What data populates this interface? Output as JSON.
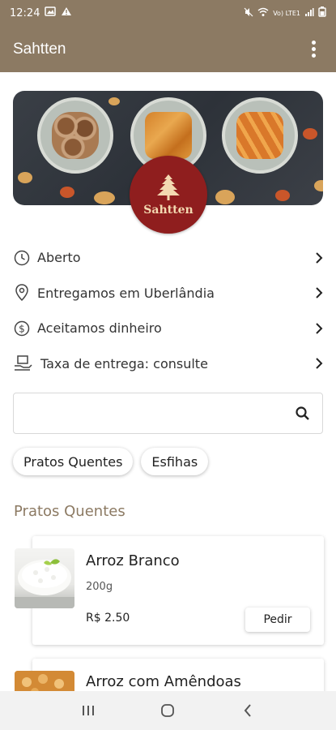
{
  "status_bar": {
    "time": "12:24",
    "signal_text": "Vo) LTE1"
  },
  "app_bar": {
    "title": "Sahtten",
    "menu_icon": "more-vert-icon"
  },
  "banner": {
    "logo_text": "Sahtten"
  },
  "info": [
    {
      "icon": "clock-icon",
      "label": "Aberto"
    },
    {
      "icon": "location-pin-icon",
      "label": "Entregamos em Uberlândia"
    },
    {
      "icon": "dollar-icon",
      "label": "Aceitamos dinheiro"
    },
    {
      "icon": "delivery-hand-icon",
      "label": "Taxa de entrega: consulte"
    }
  ],
  "search": {
    "value": "",
    "placeholder": ""
  },
  "categories": [
    {
      "label": "Pratos Quentes"
    },
    {
      "label": "Esfihas"
    }
  ],
  "section": {
    "title": "Pratos Quentes"
  },
  "products": [
    {
      "name": "Arroz Branco",
      "description": "200g",
      "price": "R$ 2.50",
      "button": "Pedir"
    },
    {
      "name": "Arroz com Amêndoas"
    }
  ],
  "colors": {
    "brand": "#8c7a63",
    "logo": "#8f1e1e"
  }
}
